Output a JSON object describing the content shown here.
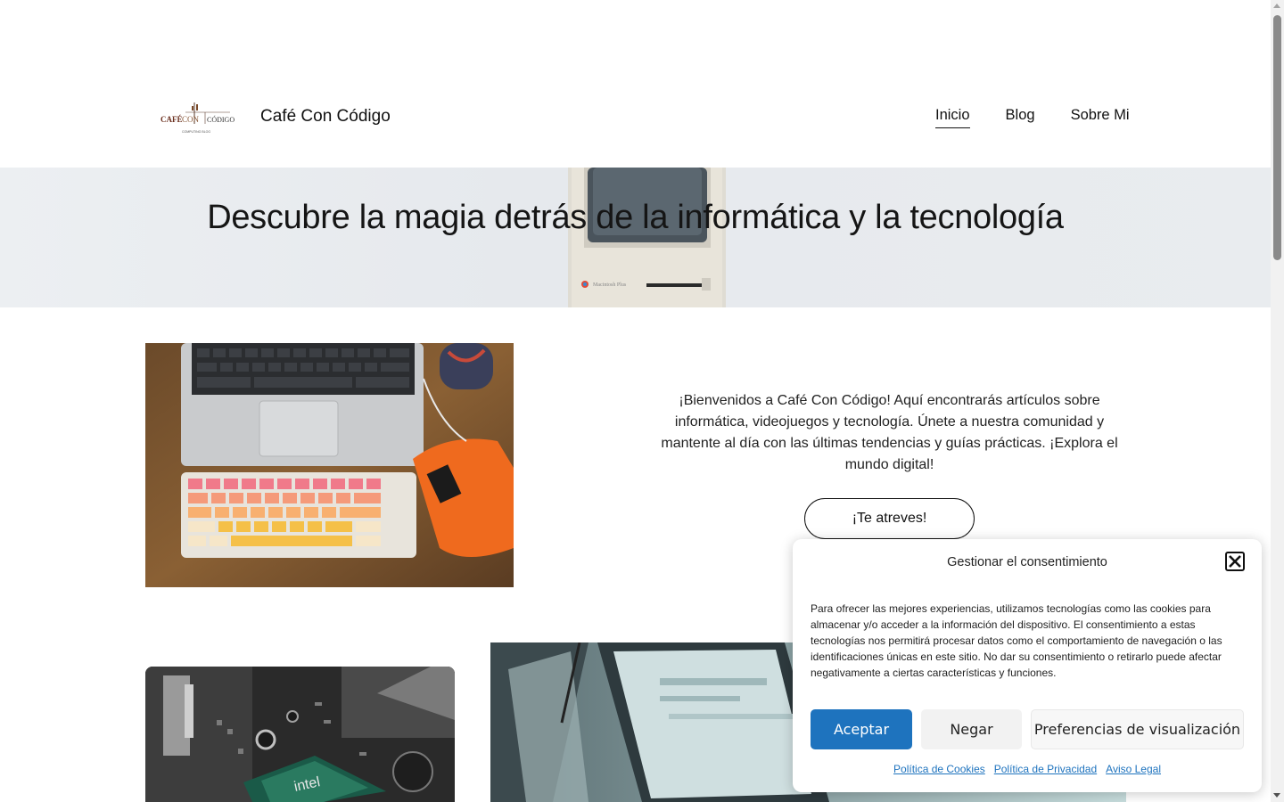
{
  "header": {
    "logo_text_main": "CAFÉ CON CÓDIGO",
    "logo_text_sub": "COMPUTING BLOG",
    "site_title": "Café Con Código",
    "nav": [
      {
        "label": "Inicio",
        "active": true
      },
      {
        "label": "Blog",
        "active": false
      },
      {
        "label": "Sobre Mi",
        "active": false
      }
    ]
  },
  "hero": {
    "title": "Descubre la magia detrás de la informática y la tecnología",
    "image_label": "Macintosh Plus"
  },
  "intro": {
    "text": "¡Bienvenidos a Café Con Código! Aquí encontrarás artículos sobre informática, videojuegos y tecnología. Únete a nuestra comunidad y mantente al día con las últimas tendencias y guías prácticas. ¡Explora el mundo digital!",
    "cta_label": "¡Te atreves!"
  },
  "consent": {
    "title": "Gestionar el consentimiento",
    "body": "Para ofrecer las mejores experiencias, utilizamos tecnologías como las cookies para almacenar y/o acceder a la información del dispositivo. El consentimiento a estas tecnologías nos permitirá procesar datos como el comportamiento de navegación o las identificaciones únicas en este sitio. No dar su consentimiento o retirarlo puede afectar negativamente a ciertas características y funciones.",
    "accept_label": "Aceptar",
    "deny_label": "Negar",
    "prefs_label": "Preferencias de visualización",
    "links": [
      "Política de Cookies",
      "Política de Privacidad",
      "Aviso Legal"
    ]
  },
  "colors": {
    "accent": "#1e73be",
    "text": "#111111",
    "background": "#ffffff"
  }
}
